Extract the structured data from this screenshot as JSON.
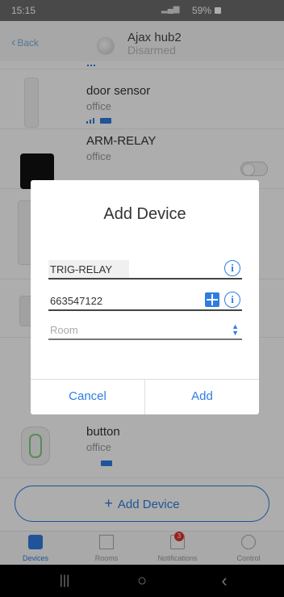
{
  "status": {
    "time": "15:15",
    "signal": "⋅∴╲∙╲",
    "battery": "59%"
  },
  "header": {
    "back_label": "Back",
    "hub_name": "Ajax hub2",
    "hub_status": "Disarmed"
  },
  "devices": [
    {
      "name": "door sensor",
      "room": "office"
    },
    {
      "name": "ARM-RELAY",
      "room": "office"
    },
    {
      "name": "button",
      "room": "office"
    }
  ],
  "dialog": {
    "title": "Add Device",
    "name_value": "TRIG-RELAY",
    "id_value": "663547122",
    "room_placeholder": "Room",
    "cancel_label": "Cancel",
    "add_label": "Add"
  },
  "add_device_button": {
    "label": "Add Device"
  },
  "tabs": [
    {
      "label": "Devices",
      "active": true
    },
    {
      "label": "Rooms",
      "active": false
    },
    {
      "label": "Notifications",
      "active": false,
      "badge": "3"
    },
    {
      "label": "Control",
      "active": false
    }
  ],
  "navbar": {
    "recents": "|||",
    "home": "○",
    "back": "‹"
  },
  "colors": {
    "accent": "#2f7de1",
    "overlay": "rgba(0,0,0,0.32)",
    "badge": "#e0322b"
  }
}
